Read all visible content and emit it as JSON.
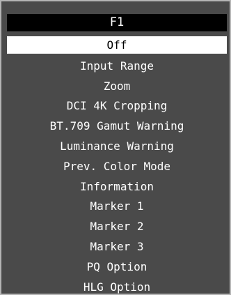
{
  "menu": {
    "title": "F1",
    "items": [
      {
        "label": "Off",
        "selected": true
      },
      {
        "label": "Input Range",
        "selected": false
      },
      {
        "label": "Zoom",
        "selected": false
      },
      {
        "label": "DCI 4K Cropping",
        "selected": false
      },
      {
        "label": "BT.709 Gamut Warning",
        "selected": false
      },
      {
        "label": "Luminance Warning",
        "selected": false
      },
      {
        "label": "Prev. Color Mode",
        "selected": false
      },
      {
        "label": "Information",
        "selected": false
      },
      {
        "label": "Marker 1",
        "selected": false
      },
      {
        "label": "Marker 2",
        "selected": false
      },
      {
        "label": "Marker 3",
        "selected": false
      },
      {
        "label": "PQ Option",
        "selected": false
      },
      {
        "label": "HLG Option",
        "selected": false
      }
    ]
  },
  "colors": {
    "panel_background": "#4a4a4a",
    "header_background": "#000000",
    "selected_background": "#ffffff",
    "text": "#ffffff",
    "selected_text": "#000000",
    "border": "#b4b4b4"
  }
}
